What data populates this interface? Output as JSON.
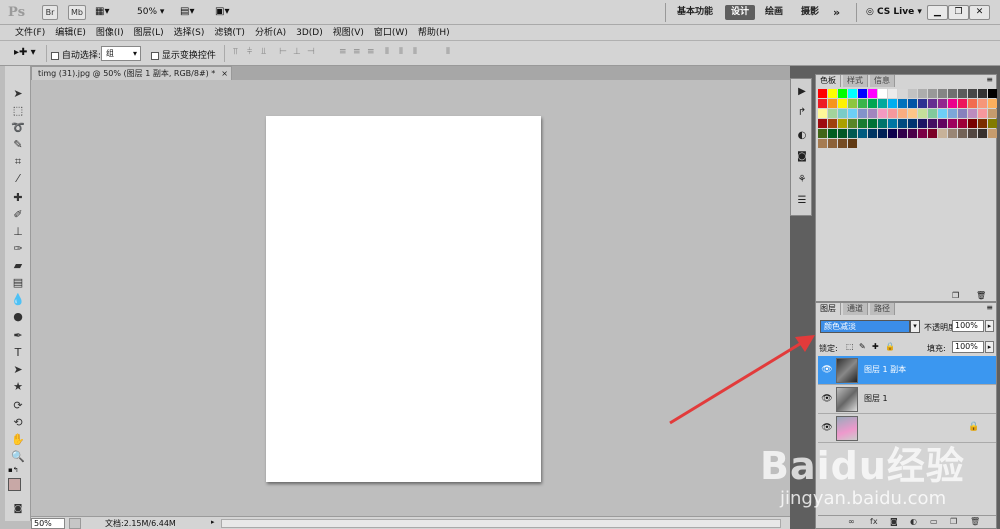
{
  "titlebar": {
    "logo": "Ps",
    "br": "Br",
    "mb": "Mb",
    "zoom": "50%",
    "workspaces": [
      "基本功能",
      "设计",
      "绘画",
      "摄影"
    ],
    "more": "»",
    "cslive": "CS Live"
  },
  "menu": [
    "文件(F)",
    "编辑(E)",
    "图像(I)",
    "图层(L)",
    "选择(S)",
    "滤镜(T)",
    "分析(A)",
    "3D(D)",
    "视图(V)",
    "窗口(W)",
    "帮助(H)"
  ],
  "options": {
    "auto_select_label": "自动选择:",
    "auto_select_value": "组",
    "show_transform_label": "显示变换控件"
  },
  "document": {
    "tab_title": "timg (31).jpg @ 50% (图层 1 副本, RGB/8#) *",
    "tab_close": "×"
  },
  "status": {
    "zoom": "50%",
    "doc_info": "文档:2.15M/6.44M"
  },
  "swatch_panel": {
    "tabs": [
      "色板",
      "样式",
      "信息"
    ]
  },
  "layers_panel": {
    "tabs": [
      "图层",
      "通道",
      "路径"
    ],
    "blend_mode": "颜色减淡",
    "opacity_label": "不透明度:",
    "opacity_value": "100%",
    "lock_label": "锁定:",
    "fill_label": "填充:",
    "fill_value": "100%",
    "layers": [
      {
        "name": "图层 1 副本",
        "selected": true
      },
      {
        "name": "图层 1",
        "selected": false
      },
      {
        "name": "",
        "selected": false
      }
    ]
  },
  "watermark": {
    "line1": "Baidu经验",
    "line2": "jingyan.baidu.com"
  },
  "colors": {
    "accent": "#3b97f0",
    "arrow": "#e23b3b"
  }
}
